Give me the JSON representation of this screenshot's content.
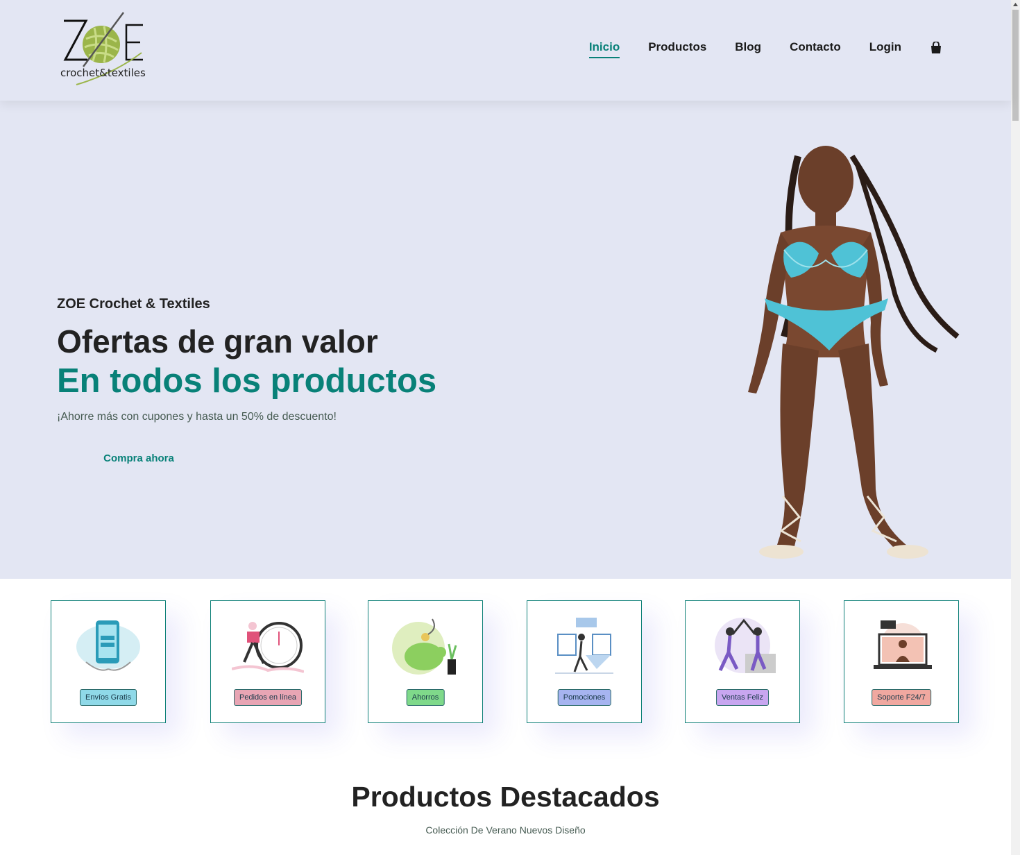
{
  "header": {
    "logo": {
      "wordmark": "ZOE",
      "tagline": "crochet&textiles"
    },
    "nav": [
      {
        "label": "Inicio",
        "active": true
      },
      {
        "label": "Productos",
        "active": false
      },
      {
        "label": "Blog",
        "active": false
      },
      {
        "label": "Contacto",
        "active": false
      },
      {
        "label": "Login",
        "active": false
      }
    ],
    "cart_icon": "shopping-bag-icon"
  },
  "hero": {
    "subtitle": "ZOE Crochet & Textiles",
    "title": "Ofertas de gran valor",
    "title_highlight": "En todos los productos",
    "description": "¡Ahorre más con cupones y hasta un 50% de descuento!",
    "cta": "Compra ahora",
    "image": "model-in-crochet-bikini"
  },
  "features": [
    {
      "label": "Envíos Gratis",
      "color": "#8fd9e8",
      "icon": "mobile-delivery-illustration"
    },
    {
      "label": "Pedidos en línea",
      "color": "#e8a5b4",
      "icon": "online-order-clock-illustration"
    },
    {
      "label": "Ahorros",
      "color": "#7fd98a",
      "icon": "piggy-bank-illustration"
    },
    {
      "label": "Pomociones",
      "color": "#a6b4f0",
      "icon": "promotions-illustration"
    },
    {
      "label": "Ventas Feliz",
      "color": "#c8a6f0",
      "icon": "happy-sales-illustration"
    },
    {
      "label": "Soporte F24/7",
      "color": "#f0a8a0",
      "icon": "support-laptop-illustration"
    }
  ],
  "featured": {
    "title": "Productos Destacados",
    "subtitle": "Colección De Verano Nuevos Diseño"
  },
  "colors": {
    "accent": "#088178",
    "hero_bg": "#e3e6f3",
    "text": "#222222"
  }
}
